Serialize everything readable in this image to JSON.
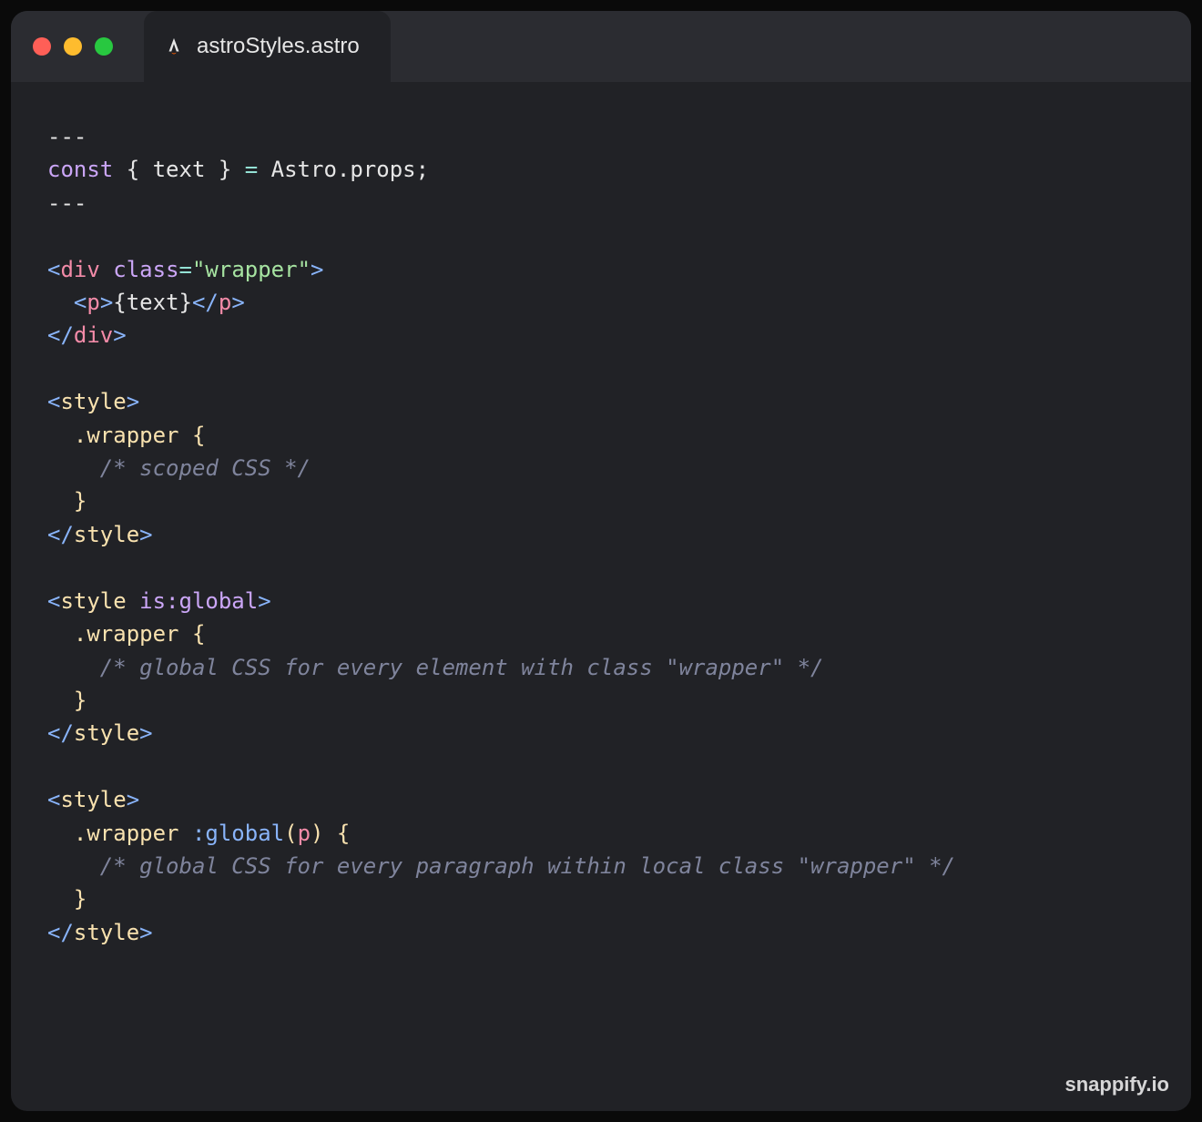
{
  "window": {
    "traffic": [
      "close",
      "minimize",
      "fullscreen"
    ]
  },
  "tab": {
    "icon": "astro-icon",
    "filename": "astroStyles.astro"
  },
  "watermark": "snappify.io",
  "code": {
    "lines": [
      [
        {
          "c": "t-delim",
          "t": "---"
        }
      ],
      [
        {
          "c": "t-kw",
          "t": "const"
        },
        {
          "c": "t-ident",
          "t": " { text } "
        },
        {
          "c": "t-op",
          "t": "="
        },
        {
          "c": "t-ident",
          "t": " Astro.props;"
        }
      ],
      [
        {
          "c": "t-delim",
          "t": "---"
        }
      ],
      [
        {
          "c": "",
          "t": ""
        }
      ],
      [
        {
          "c": "t-angle",
          "t": "<"
        },
        {
          "c": "t-tag",
          "t": "div"
        },
        {
          "c": "t-ident",
          "t": " "
        },
        {
          "c": "t-attr",
          "t": "class"
        },
        {
          "c": "t-eq",
          "t": "="
        },
        {
          "c": "t-str",
          "t": "\"wrapper\""
        },
        {
          "c": "t-angle",
          "t": ">"
        }
      ],
      [
        {
          "c": "t-ident",
          "t": "  "
        },
        {
          "c": "t-angle",
          "t": "<"
        },
        {
          "c": "t-tag",
          "t": "p"
        },
        {
          "c": "t-angle",
          "t": ">"
        },
        {
          "c": "t-ident",
          "t": "{text}"
        },
        {
          "c": "t-angle",
          "t": "</"
        },
        {
          "c": "t-tag",
          "t": "p"
        },
        {
          "c": "t-angle",
          "t": ">"
        }
      ],
      [
        {
          "c": "t-angle",
          "t": "</"
        },
        {
          "c": "t-tag",
          "t": "div"
        },
        {
          "c": "t-angle",
          "t": ">"
        }
      ],
      [
        {
          "c": "",
          "t": ""
        }
      ],
      [
        {
          "c": "t-angle",
          "t": "<"
        },
        {
          "c": "t-styletag",
          "t": "style"
        },
        {
          "c": "t-angle",
          "t": ">"
        }
      ],
      [
        {
          "c": "t-ident",
          "t": "  "
        },
        {
          "c": "t-class",
          "t": ".wrapper"
        },
        {
          "c": "t-ident",
          "t": " "
        },
        {
          "c": "t-brace",
          "t": "{"
        }
      ],
      [
        {
          "c": "t-ident",
          "t": "    "
        },
        {
          "c": "t-comment",
          "t": "/* scoped CSS */"
        }
      ],
      [
        {
          "c": "t-ident",
          "t": "  "
        },
        {
          "c": "t-brace",
          "t": "}"
        }
      ],
      [
        {
          "c": "t-angle",
          "t": "</"
        },
        {
          "c": "t-styletag",
          "t": "style"
        },
        {
          "c": "t-angle",
          "t": ">"
        }
      ],
      [
        {
          "c": "",
          "t": ""
        }
      ],
      [
        {
          "c": "t-angle",
          "t": "<"
        },
        {
          "c": "t-styletag",
          "t": "style"
        },
        {
          "c": "t-ident",
          "t": " "
        },
        {
          "c": "t-attr",
          "t": "is:global"
        },
        {
          "c": "t-angle",
          "t": ">"
        }
      ],
      [
        {
          "c": "t-ident",
          "t": "  "
        },
        {
          "c": "t-class",
          "t": ".wrapper"
        },
        {
          "c": "t-ident",
          "t": " "
        },
        {
          "c": "t-brace",
          "t": "{"
        }
      ],
      [
        {
          "c": "t-ident",
          "t": "    "
        },
        {
          "c": "t-comment",
          "t": "/* global CSS for every element with class \"wrapper\" */"
        }
      ],
      [
        {
          "c": "t-ident",
          "t": "  "
        },
        {
          "c": "t-brace",
          "t": "}"
        }
      ],
      [
        {
          "c": "t-angle",
          "t": "</"
        },
        {
          "c": "t-styletag",
          "t": "style"
        },
        {
          "c": "t-angle",
          "t": ">"
        }
      ],
      [
        {
          "c": "",
          "t": ""
        }
      ],
      [
        {
          "c": "t-angle",
          "t": "<"
        },
        {
          "c": "t-styletag",
          "t": "style"
        },
        {
          "c": "t-angle",
          "t": ">"
        }
      ],
      [
        {
          "c": "t-ident",
          "t": "  "
        },
        {
          "c": "t-class",
          "t": ".wrapper"
        },
        {
          "c": "t-ident",
          "t": " "
        },
        {
          "c": "t-pseudo",
          "t": ":"
        },
        {
          "c": "t-call",
          "t": "global"
        },
        {
          "c": "t-brace",
          "t": "("
        },
        {
          "c": "t-tag",
          "t": "p"
        },
        {
          "c": "t-brace",
          "t": ")"
        },
        {
          "c": "t-ident",
          "t": " "
        },
        {
          "c": "t-brace",
          "t": "{"
        }
      ],
      [
        {
          "c": "t-ident",
          "t": "    "
        },
        {
          "c": "t-comment",
          "t": "/* global CSS for every paragraph within local class \"wrapper\" */"
        }
      ],
      [
        {
          "c": "t-ident",
          "t": "  "
        },
        {
          "c": "t-brace",
          "t": "}"
        }
      ],
      [
        {
          "c": "t-angle",
          "t": "</"
        },
        {
          "c": "t-styletag",
          "t": "style"
        },
        {
          "c": "t-angle",
          "t": ">"
        }
      ]
    ]
  }
}
